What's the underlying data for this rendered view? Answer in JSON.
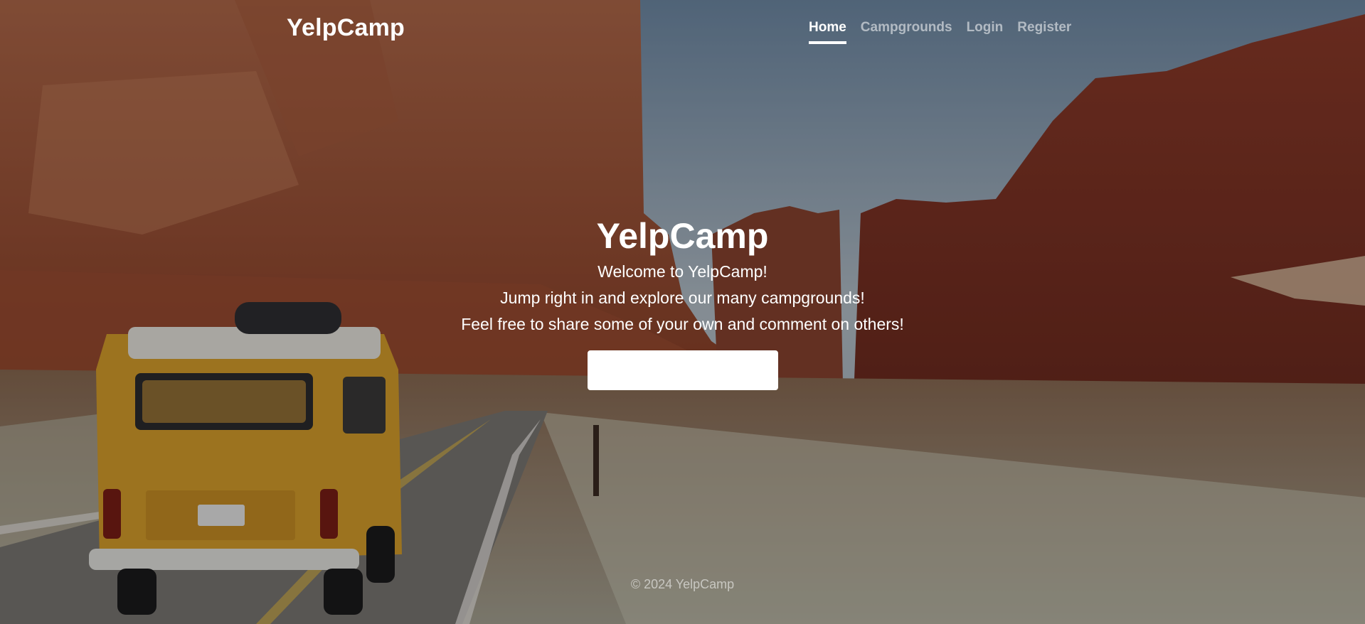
{
  "header": {
    "brand": "YelpCamp",
    "nav": [
      {
        "label": "Home",
        "active": true
      },
      {
        "label": "Campgrounds",
        "active": false
      },
      {
        "label": "Login",
        "active": false
      },
      {
        "label": "Register",
        "active": false
      }
    ]
  },
  "hero": {
    "title": "YelpCamp",
    "lines": [
      "Welcome to YelpCamp!",
      "Jump right in and explore our many campgrounds!",
      "Feel free to share some of your own and comment on others!"
    ],
    "button_label": ""
  },
  "footer": {
    "text": "© 2024 YelpCamp"
  },
  "background": {
    "description_icon": "desert-canyon-road-photo",
    "colors": {
      "sky": "#8fa7bd",
      "rock": "#9a4a2e",
      "ground": "#8d7258",
      "road": "#6f6c68",
      "van": "#d8a02c"
    }
  }
}
